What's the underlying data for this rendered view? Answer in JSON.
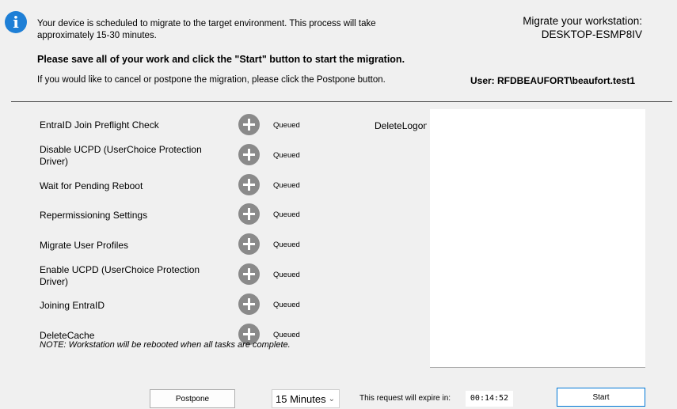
{
  "header": {
    "message_line1": "Your device is scheduled to migrate to the target environment. This process will take approximately 15-30 minutes.",
    "message_bold": "Please save all of your work and click the \"Start\" button to start the migration.",
    "message_cancel": "If you would like to cancel or postpone the migration, please click the Postpone button.",
    "workstation_label": "Migrate your workstation:",
    "workstation_name": "DESKTOP-ESMP8IV",
    "user_label": "User: RFDBEAUFORT\\beaufort.test1"
  },
  "tasks": [
    {
      "label": "EntraID Join Preflight Check",
      "status": "Queued"
    },
    {
      "label": "Disable UCPD (UserChoice Protection Driver)",
      "status": "Queued"
    },
    {
      "label": "Wait for Pending Reboot",
      "status": "Queued"
    },
    {
      "label": "Repermissioning Settings",
      "status": "Queued"
    },
    {
      "label": "Migrate User Profiles",
      "status": "Queued"
    },
    {
      "label": "Enable UCPD (UserChoice Protection Driver)",
      "status": "Queued"
    },
    {
      "label": "Joining EntraID",
      "status": "Queued"
    },
    {
      "label": "DeleteCache",
      "status": "Queued"
    }
  ],
  "side_task_label": "DeleteLogon",
  "note": "NOTE: Workstation will be rebooted when all tasks are complete.",
  "footer": {
    "postpone_label": "Postpone",
    "postpone_duration": "15 Minutes",
    "expire_label": "This request will expire in:",
    "timer": "00:14:52",
    "start_label": "Start"
  },
  "icons": {
    "info": "info-icon",
    "task_status": "plus-circle-icon",
    "dropdown": "chevron-down-icon"
  },
  "colors": {
    "accent": "#0078d7",
    "info_icon": "#1e7fd6",
    "status_icon": "#8a8a8a"
  }
}
